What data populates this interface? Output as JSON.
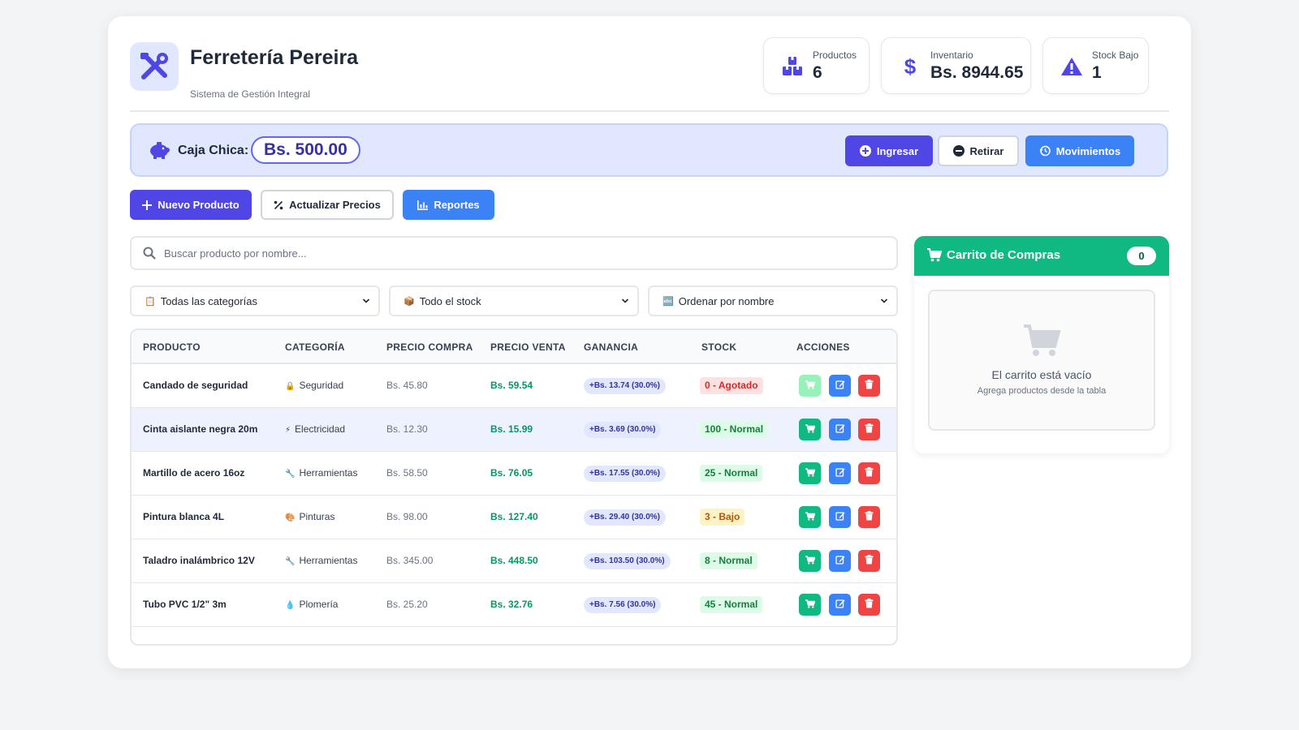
{
  "brand": {
    "title": "Ferretería Pereira",
    "subtitle": "Sistema de Gestión Integral"
  },
  "stats": [
    {
      "label": "Productos",
      "value": "6",
      "icon": "boxes-icon"
    },
    {
      "label": "Inventario",
      "value": "Bs. 8944.65",
      "icon": "dollar-icon"
    },
    {
      "label": "Stock Bajo",
      "value": "1",
      "icon": "warning-icon"
    }
  ],
  "caja": {
    "label": "Caja Chica:",
    "amount": "Bs. 500.00",
    "buttons": {
      "ingresar": "Ingresar",
      "retirar": "Retirar",
      "movimientos": "Movimientos"
    }
  },
  "toolbar": {
    "nuevo": "Nuevo Producto",
    "actualizar": "Actualizar Precios",
    "reportes": "Reportes"
  },
  "search": {
    "placeholder": "Buscar producto por nombre..."
  },
  "filters": {
    "categoria": {
      "emoji": "📋",
      "label": "Todas las categorías"
    },
    "stock": {
      "emoji": "📦",
      "label": "Todo el stock"
    },
    "orden": {
      "emoji": "🔤",
      "label": "Ordenar por nombre"
    }
  },
  "table": {
    "headers": [
      "PRODUCTO",
      "CATEGORÍA",
      "PRECIO COMPRA",
      "PRECIO VENTA",
      "GANANCIA",
      "STOCK",
      "ACCIONES"
    ],
    "rows": [
      {
        "name": "Candado de seguridad",
        "cat_emoji": "🔒",
        "category": "Seguridad",
        "buy": "Bs. 45.80",
        "sell": "Bs. 59.54",
        "gain": "+Bs. 13.74 (30.0%)",
        "stock": "0 - Agotado",
        "stock_state": "out",
        "cart_disabled": true
      },
      {
        "name": "Cinta aislante negra 20m",
        "cat_emoji": "⚡",
        "category": "Electricidad",
        "buy": "Bs. 12.30",
        "sell": "Bs. 15.99",
        "gain": "+Bs. 3.69 (30.0%)",
        "stock": "100 - Normal",
        "stock_state": "ok",
        "cart_disabled": false
      },
      {
        "name": "Martillo de acero 16oz",
        "cat_emoji": "🔧",
        "category": "Herramientas",
        "buy": "Bs. 58.50",
        "sell": "Bs. 76.05",
        "gain": "+Bs. 17.55 (30.0%)",
        "stock": "25 - Normal",
        "stock_state": "ok",
        "cart_disabled": false
      },
      {
        "name": "Pintura blanca 4L",
        "cat_emoji": "🎨",
        "category": "Pinturas",
        "buy": "Bs. 98.00",
        "sell": "Bs. 127.40",
        "gain": "+Bs. 29.40 (30.0%)",
        "stock": "3 - Bajo",
        "stock_state": "low",
        "cart_disabled": false
      },
      {
        "name": "Taladro inalámbrico 12V",
        "cat_emoji": "🔧",
        "category": "Herramientas",
        "buy": "Bs. 345.00",
        "sell": "Bs. 448.50",
        "gain": "+Bs. 103.50 (30.0%)",
        "stock": "8 - Normal",
        "stock_state": "ok",
        "cart_disabled": false
      },
      {
        "name": "Tubo PVC 1/2\" 3m",
        "cat_emoji": "💧",
        "category": "Plomería",
        "buy": "Bs. 25.20",
        "sell": "Bs. 32.76",
        "gain": "+Bs. 7.56 (30.0%)",
        "stock": "45 - Normal",
        "stock_state": "ok",
        "cart_disabled": false
      }
    ]
  },
  "cart": {
    "title": "Carrito de Compras",
    "count": "0",
    "empty_title": "El carrito está vacío",
    "empty_sub": "Agrega productos desde la tabla"
  },
  "colors": {
    "primary": "#4f46e5",
    "accent_blue": "#3b82f6",
    "success": "#10b981",
    "danger": "#ef4444"
  }
}
